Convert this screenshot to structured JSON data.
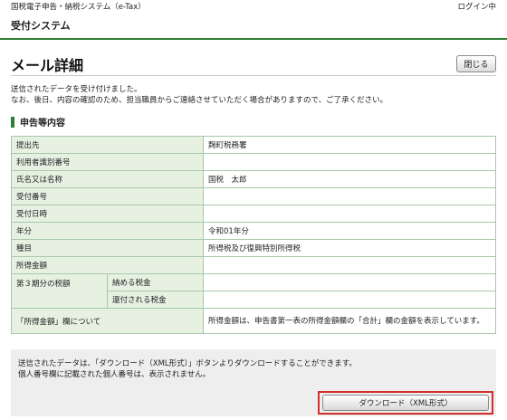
{
  "header": {
    "system_name": "国税電子申告・納税システム（e-Tax）",
    "login_status": "ログイン中",
    "subsystem": "受付システム"
  },
  "page": {
    "title": "メール詳細",
    "close_label": "閉じる",
    "notice_line1": "送信されたデータを受け付けました。",
    "notice_line2": "なお、後日、内容の確認のため、担当職員からご連絡させていただく場合がありますので、ご了承ください。"
  },
  "section": {
    "title": "申告等内容"
  },
  "table": {
    "rows": [
      {
        "label": "提出先",
        "value": "麹町税務署"
      },
      {
        "label": "利用者識別番号",
        "value": ""
      },
      {
        "label": "氏名又は名称",
        "value": "国税　太郎"
      },
      {
        "label": "受付番号",
        "value": ""
      },
      {
        "label": "受付日時",
        "value": ""
      },
      {
        "label": "年分",
        "value": "令和01年分"
      },
      {
        "label": "種目",
        "value": "所得税及び復興特別所得税"
      },
      {
        "label": "所得金額",
        "value": ""
      }
    ],
    "tax_group": {
      "label": "第３期分の税額",
      "pay_label": "納める税金",
      "pay_value": "",
      "refund_label": "還付される税金",
      "refund_value": ""
    },
    "income_note": {
      "label": "「所得金額」欄について",
      "value": "所得金額は、申告書第一表の所得金額欄の「合計」欄の金額を表示しています。"
    }
  },
  "footer": {
    "line1": "送信されたデータは、「ダウンロード（XML形式）」ボタンよりダウンロードすることができます。",
    "line2": "個人番号欄に記載された個人番号は、表示されません。",
    "download_label": "ダウンロード（XML形式）"
  },
  "colors": {
    "accent_green": "#2e7d32",
    "label_bg": "#e6f1e2",
    "highlight_red": "#d32f2f"
  }
}
